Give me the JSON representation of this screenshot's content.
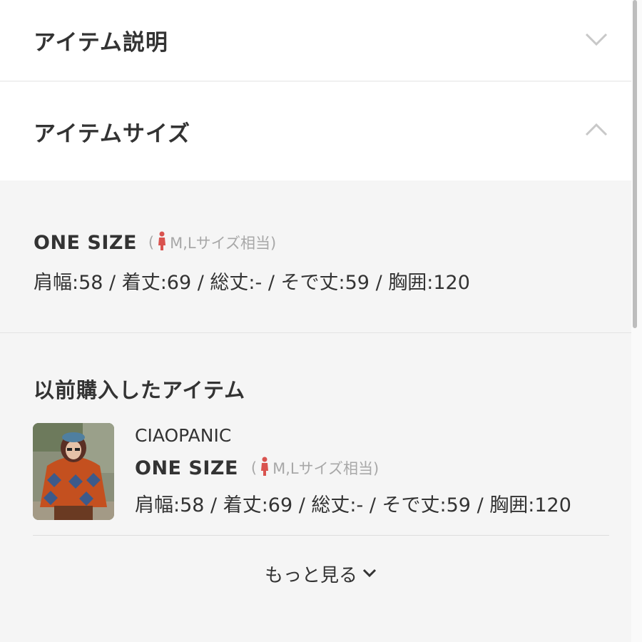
{
  "accordion": [
    {
      "label": "アイテム説明",
      "state": "collapsed",
      "icon": "chevron-down-icon"
    },
    {
      "label": "アイテムサイズ",
      "state": "expanded",
      "icon": "chevron-up-icon"
    }
  ],
  "size": {
    "name": "ONE SIZE",
    "paren_open": "(",
    "equivalent": "M,Lサイズ相当)",
    "measurements": "肩幅:58 / 着丈:69 / 総丈:- / そで丈:59 / 胸囲:120",
    "icon": "person-icon"
  },
  "previous": {
    "title": "以前購入したアイテム",
    "items": [
      {
        "brand": "CIAOPANIC",
        "size_name": "ONE SIZE",
        "paren_open": "(",
        "equivalent": "M,Lサイズ相当)",
        "measurements": "肩幅:58 / 着丈:69 / 総丈:- / そで丈:59 / 胸囲:120"
      }
    ],
    "more_label": "もっと見る"
  },
  "colors": {
    "accent_icon": "#d9534f",
    "text": "#333333",
    "muted": "#a8a8a8",
    "background": "#f5f5f5"
  }
}
